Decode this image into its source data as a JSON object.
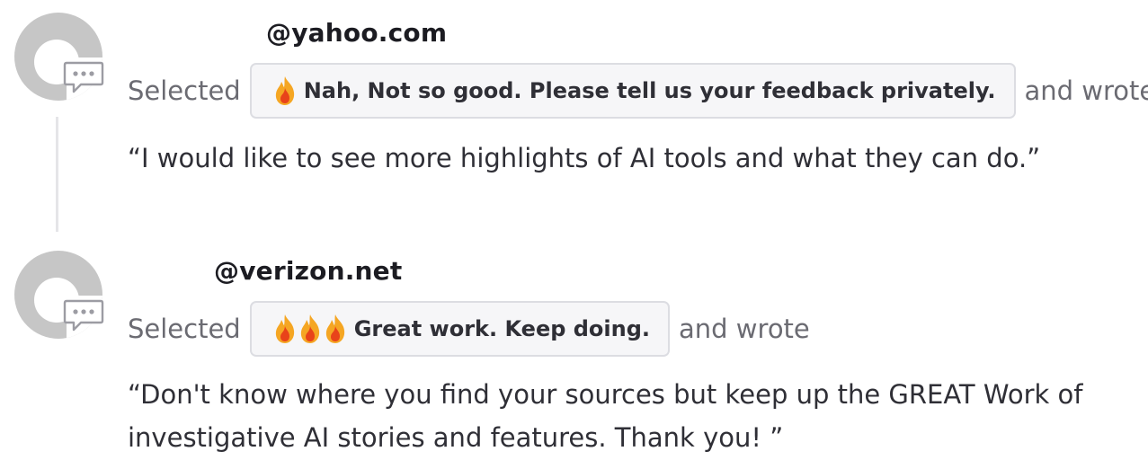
{
  "entries": [
    {
      "handle": "@yahoo.com",
      "selected_label": "Selected",
      "reaction": "Nah, Not so good. Please tell us your feedback privately.",
      "flame_count": 1,
      "wrote_label": "and wrote",
      "comment": "“I would like to see more highlights of AI tools and what they can do.”"
    },
    {
      "handle": "@verizon.net",
      "selected_label": "Selected",
      "reaction": "Great work. Keep doing.",
      "flame_count": 3,
      "wrote_label": "and wrote",
      "comment": "“Don't know where you find your sources but keep up the GREAT Work of investigative AI stories and features. Thank you! ”"
    }
  ],
  "icons": {
    "avatar": "default-avatar-icon",
    "comment": "speech-bubble-icon",
    "reaction": "flame-icon"
  },
  "colors": {
    "avatar": "#c6c6c6",
    "pill_border": "#dcdde2",
    "pill_background": "#f6f6f8",
    "muted_text": "#6b6b72",
    "body_text": "#2f2f36",
    "flame_outer": "#f5a623",
    "flame_inner": "#e8431a"
  }
}
